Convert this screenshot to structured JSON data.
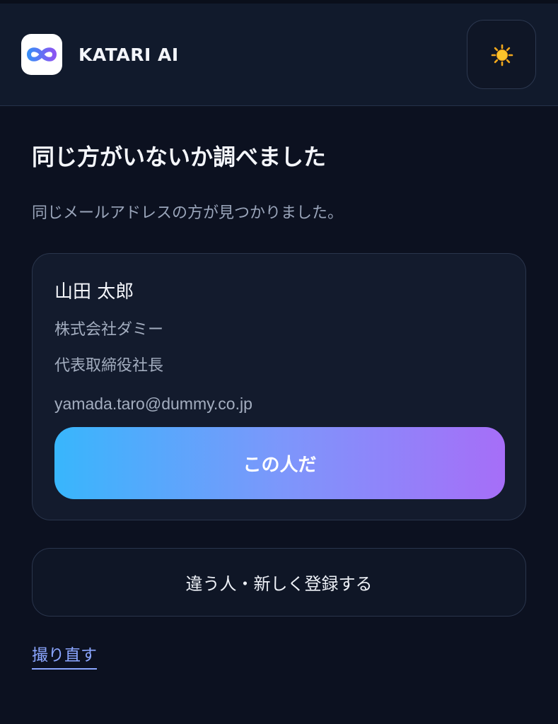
{
  "header": {
    "app_name": "KATARI AI",
    "logo_icon": "infinity-logo-icon",
    "theme_toggle_icon": "sun-icon"
  },
  "main": {
    "title": "同じ方がいないか調べました",
    "subtitle": "同じメールアドレスの方が見つかりました。"
  },
  "match_card": {
    "name": "山田 太郎",
    "company": "株式会社ダミー",
    "role": "代表取締役社長",
    "email": "yamada.taro@dummy.co.jp",
    "confirm_label": "この人だ"
  },
  "actions": {
    "register_label": "違う人・新しく登録する",
    "retake_label": "撮り直す"
  },
  "colors": {
    "background": "#0c1120",
    "card": "#131b2d",
    "accent_gradient_start": "#38b6fc",
    "accent_gradient_end": "#a66ef8",
    "link": "#8ba6ff"
  }
}
